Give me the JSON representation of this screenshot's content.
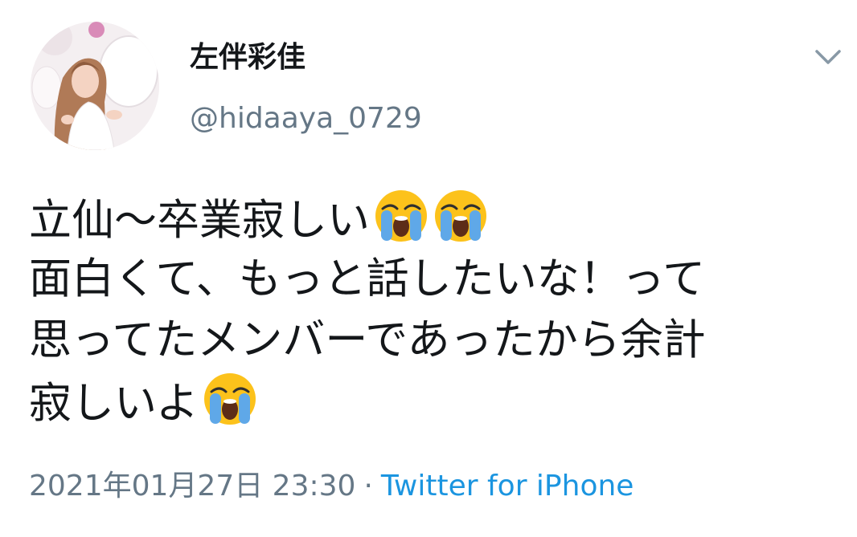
{
  "user": {
    "display_name": "左伴彩佳",
    "handle": "@hidaaya_0729"
  },
  "tweet": {
    "lines": [
      "立仙〜卒業寂しい",
      "面白くて、もっと話したいな！って",
      "思ってたメンバーであったから余計",
      "寂しいよ"
    ],
    "emoji_icon": "loudly-crying-face-icon"
  },
  "meta": {
    "timestamp": "2021年01月27日 23:30",
    "separator": "·",
    "source": "Twitter for iPhone"
  },
  "colors": {
    "text": "#14171a",
    "secondary": "#657786",
    "link": "#1b95e0"
  }
}
